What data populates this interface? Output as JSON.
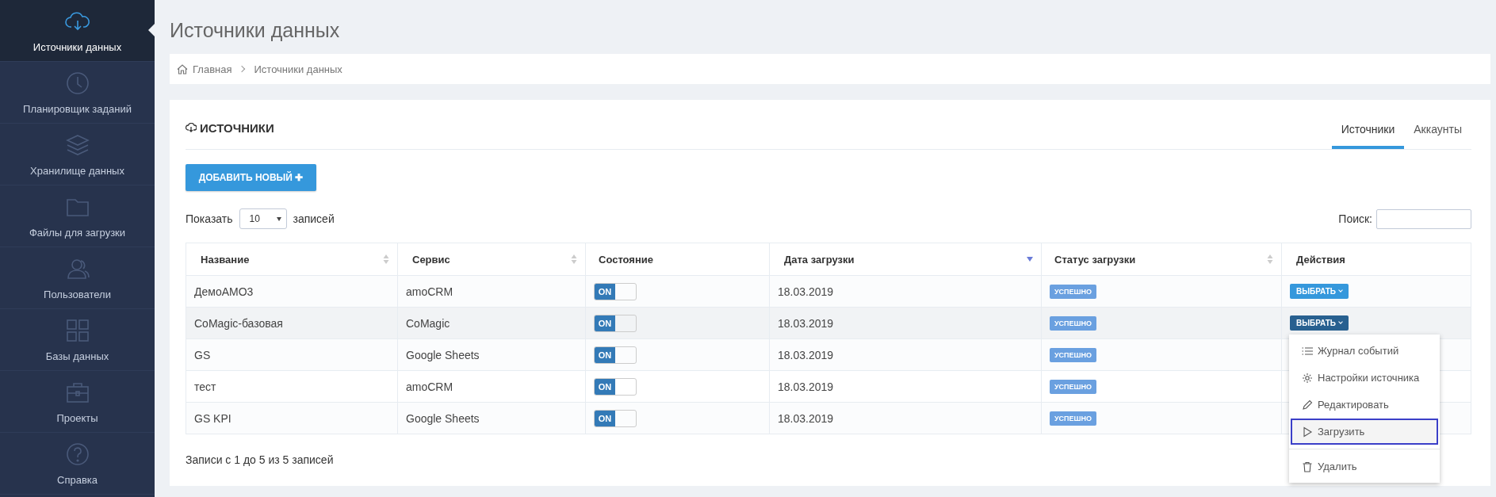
{
  "sidebar": {
    "items": [
      {
        "label": "Источники данных",
        "selected": true
      },
      {
        "label": "Планировщик заданий",
        "selected": false
      },
      {
        "label": "Хранилище данных",
        "selected": false
      },
      {
        "label": "Файлы для загрузки",
        "selected": false
      },
      {
        "label": "Пользователи",
        "selected": false
      },
      {
        "label": "Базы данных",
        "selected": false
      },
      {
        "label": "Проекты",
        "selected": false
      },
      {
        "label": "Справка",
        "selected": false
      }
    ]
  },
  "page_title": "Источники данных",
  "breadcrumbs": [
    "Главная",
    "Источники данных"
  ],
  "card": {
    "title": "ИСТОЧНИКИ",
    "tabs": [
      {
        "label": "Источники",
        "selected": true
      },
      {
        "label": "Аккаунты",
        "selected": false
      }
    ],
    "add_button": "ДОБАВИТЬ НОВЫЙ",
    "add_button_icon": "✚",
    "show_label": "Показать",
    "page_size": "10",
    "entries_label": "записей",
    "search_label": "Поиск:",
    "table": {
      "columns": [
        {
          "label": "Название",
          "sortable": true,
          "sorted_descending": false
        },
        {
          "label": "Сервис",
          "sortable": true,
          "sorted_descending": false
        },
        {
          "label": "Состояние",
          "sortable": false
        },
        {
          "label": "Дата загрузки",
          "sortable": true,
          "sorted_descending": true
        },
        {
          "label": "Статус загрузки",
          "sortable": true,
          "sorted_descending": false
        },
        {
          "label": "Действия",
          "sortable": false
        }
      ],
      "rows": [
        {
          "name": "ДемоАМО3",
          "service": "amoCRM",
          "on": true,
          "toggle_label": "ON",
          "date": "18.03.2019",
          "status": "УСПЕШНО",
          "action": "ВЫБРАТЬ",
          "selected": false
        },
        {
          "name": "CoMagic-базовая",
          "service": "CoMagic",
          "on": true,
          "toggle_label": "ON",
          "date": "18.03.2019",
          "status": "УСПЕШНО",
          "action": "ВЫБРАТЬ",
          "selected": true
        },
        {
          "name": "GS",
          "service": "Google Sheets",
          "on": true,
          "toggle_label": "ON",
          "date": "18.03.2019",
          "status": "УСПЕШНО",
          "selected": false
        },
        {
          "name": "тест",
          "service": "amoCRM",
          "on": true,
          "toggle_label": "ON",
          "date": "18.03.2019",
          "status": "УСПЕШНО",
          "selected": false
        },
        {
          "name": "GS KPI",
          "service": "Google Sheets",
          "on": true,
          "toggle_label": "ON",
          "date": "18.03.2019",
          "status": "УСПЕШНО",
          "selected": false
        }
      ]
    },
    "info": "Записи с 1 до 5 из 5 записей",
    "action_menu": {
      "items": [
        {
          "label": "Журнал событий",
          "selected": false
        },
        {
          "label": "Настройки источника",
          "selected": false
        },
        {
          "label": "Редактировать",
          "selected": false
        },
        {
          "label": "Загрузить",
          "selected": true
        },
        {
          "label": "Удалить",
          "selected": false
        }
      ]
    }
  }
}
